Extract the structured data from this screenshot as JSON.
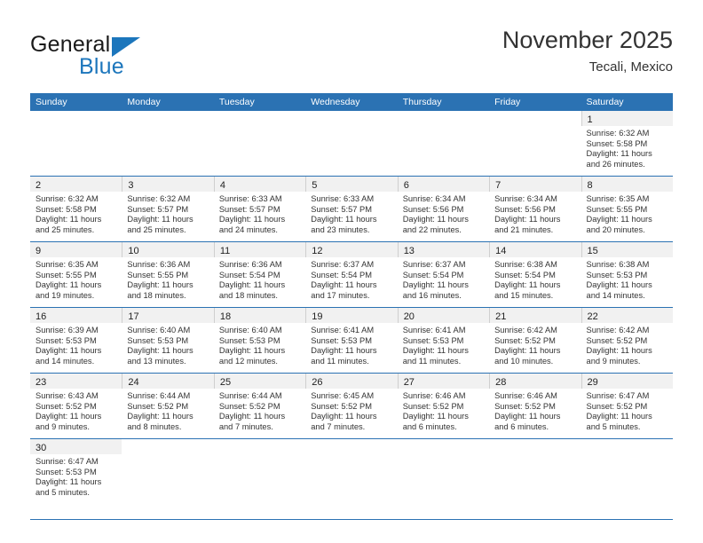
{
  "brand": {
    "word_top": "General",
    "word_bottom": "Blue",
    "accent_color": "#1c76bc"
  },
  "header": {
    "title": "November 2025",
    "subtitle": "Tecali, Mexico"
  },
  "calendar": {
    "header_bg": "#2b72b3",
    "row_divider_color": "#2b72b3",
    "daynum_band_bg": "#f1f1f1",
    "weekdays": [
      "Sunday",
      "Monday",
      "Tuesday",
      "Wednesday",
      "Thursday",
      "Friday",
      "Saturday"
    ],
    "weeks": [
      [
        {
          "day": "",
          "sunrise": "",
          "sunset": "",
          "daylight_line1": "",
          "daylight_line2": "",
          "blank": true
        },
        {
          "day": "",
          "sunrise": "",
          "sunset": "",
          "daylight_line1": "",
          "daylight_line2": "",
          "blank": true
        },
        {
          "day": "",
          "sunrise": "",
          "sunset": "",
          "daylight_line1": "",
          "daylight_line2": "",
          "blank": true
        },
        {
          "day": "",
          "sunrise": "",
          "sunset": "",
          "daylight_line1": "",
          "daylight_line2": "",
          "blank": true
        },
        {
          "day": "",
          "sunrise": "",
          "sunset": "",
          "daylight_line1": "",
          "daylight_line2": "",
          "blank": true
        },
        {
          "day": "",
          "sunrise": "",
          "sunset": "",
          "daylight_line1": "",
          "daylight_line2": "",
          "blank": true
        },
        {
          "day": "1",
          "sunrise": "Sunrise: 6:32 AM",
          "sunset": "Sunset: 5:58 PM",
          "daylight_line1": "Daylight: 11 hours",
          "daylight_line2": "and 26 minutes."
        }
      ],
      [
        {
          "day": "2",
          "sunrise": "Sunrise: 6:32 AM",
          "sunset": "Sunset: 5:58 PM",
          "daylight_line1": "Daylight: 11 hours",
          "daylight_line2": "and 25 minutes."
        },
        {
          "day": "3",
          "sunrise": "Sunrise: 6:32 AM",
          "sunset": "Sunset: 5:57 PM",
          "daylight_line1": "Daylight: 11 hours",
          "daylight_line2": "and 25 minutes."
        },
        {
          "day": "4",
          "sunrise": "Sunrise: 6:33 AM",
          "sunset": "Sunset: 5:57 PM",
          "daylight_line1": "Daylight: 11 hours",
          "daylight_line2": "and 24 minutes."
        },
        {
          "day": "5",
          "sunrise": "Sunrise: 6:33 AM",
          "sunset": "Sunset: 5:57 PM",
          "daylight_line1": "Daylight: 11 hours",
          "daylight_line2": "and 23 minutes."
        },
        {
          "day": "6",
          "sunrise": "Sunrise: 6:34 AM",
          "sunset": "Sunset: 5:56 PM",
          "daylight_line1": "Daylight: 11 hours",
          "daylight_line2": "and 22 minutes."
        },
        {
          "day": "7",
          "sunrise": "Sunrise: 6:34 AM",
          "sunset": "Sunset: 5:56 PM",
          "daylight_line1": "Daylight: 11 hours",
          "daylight_line2": "and 21 minutes."
        },
        {
          "day": "8",
          "sunrise": "Sunrise: 6:35 AM",
          "sunset": "Sunset: 5:55 PM",
          "daylight_line1": "Daylight: 11 hours",
          "daylight_line2": "and 20 minutes."
        }
      ],
      [
        {
          "day": "9",
          "sunrise": "Sunrise: 6:35 AM",
          "sunset": "Sunset: 5:55 PM",
          "daylight_line1": "Daylight: 11 hours",
          "daylight_line2": "and 19 minutes."
        },
        {
          "day": "10",
          "sunrise": "Sunrise: 6:36 AM",
          "sunset": "Sunset: 5:55 PM",
          "daylight_line1": "Daylight: 11 hours",
          "daylight_line2": "and 18 minutes."
        },
        {
          "day": "11",
          "sunrise": "Sunrise: 6:36 AM",
          "sunset": "Sunset: 5:54 PM",
          "daylight_line1": "Daylight: 11 hours",
          "daylight_line2": "and 18 minutes."
        },
        {
          "day": "12",
          "sunrise": "Sunrise: 6:37 AM",
          "sunset": "Sunset: 5:54 PM",
          "daylight_line1": "Daylight: 11 hours",
          "daylight_line2": "and 17 minutes."
        },
        {
          "day": "13",
          "sunrise": "Sunrise: 6:37 AM",
          "sunset": "Sunset: 5:54 PM",
          "daylight_line1": "Daylight: 11 hours",
          "daylight_line2": "and 16 minutes."
        },
        {
          "day": "14",
          "sunrise": "Sunrise: 6:38 AM",
          "sunset": "Sunset: 5:54 PM",
          "daylight_line1": "Daylight: 11 hours",
          "daylight_line2": "and 15 minutes."
        },
        {
          "day": "15",
          "sunrise": "Sunrise: 6:38 AM",
          "sunset": "Sunset: 5:53 PM",
          "daylight_line1": "Daylight: 11 hours",
          "daylight_line2": "and 14 minutes."
        }
      ],
      [
        {
          "day": "16",
          "sunrise": "Sunrise: 6:39 AM",
          "sunset": "Sunset: 5:53 PM",
          "daylight_line1": "Daylight: 11 hours",
          "daylight_line2": "and 14 minutes."
        },
        {
          "day": "17",
          "sunrise": "Sunrise: 6:40 AM",
          "sunset": "Sunset: 5:53 PM",
          "daylight_line1": "Daylight: 11 hours",
          "daylight_line2": "and 13 minutes."
        },
        {
          "day": "18",
          "sunrise": "Sunrise: 6:40 AM",
          "sunset": "Sunset: 5:53 PM",
          "daylight_line1": "Daylight: 11 hours",
          "daylight_line2": "and 12 minutes."
        },
        {
          "day": "19",
          "sunrise": "Sunrise: 6:41 AM",
          "sunset": "Sunset: 5:53 PM",
          "daylight_line1": "Daylight: 11 hours",
          "daylight_line2": "and 11 minutes."
        },
        {
          "day": "20",
          "sunrise": "Sunrise: 6:41 AM",
          "sunset": "Sunset: 5:53 PM",
          "daylight_line1": "Daylight: 11 hours",
          "daylight_line2": "and 11 minutes."
        },
        {
          "day": "21",
          "sunrise": "Sunrise: 6:42 AM",
          "sunset": "Sunset: 5:52 PM",
          "daylight_line1": "Daylight: 11 hours",
          "daylight_line2": "and 10 minutes."
        },
        {
          "day": "22",
          "sunrise": "Sunrise: 6:42 AM",
          "sunset": "Sunset: 5:52 PM",
          "daylight_line1": "Daylight: 11 hours",
          "daylight_line2": "and 9 minutes."
        }
      ],
      [
        {
          "day": "23",
          "sunrise": "Sunrise: 6:43 AM",
          "sunset": "Sunset: 5:52 PM",
          "daylight_line1": "Daylight: 11 hours",
          "daylight_line2": "and 9 minutes."
        },
        {
          "day": "24",
          "sunrise": "Sunrise: 6:44 AM",
          "sunset": "Sunset: 5:52 PM",
          "daylight_line1": "Daylight: 11 hours",
          "daylight_line2": "and 8 minutes."
        },
        {
          "day": "25",
          "sunrise": "Sunrise: 6:44 AM",
          "sunset": "Sunset: 5:52 PM",
          "daylight_line1": "Daylight: 11 hours",
          "daylight_line2": "and 7 minutes."
        },
        {
          "day": "26",
          "sunrise": "Sunrise: 6:45 AM",
          "sunset": "Sunset: 5:52 PM",
          "daylight_line1": "Daylight: 11 hours",
          "daylight_line2": "and 7 minutes."
        },
        {
          "day": "27",
          "sunrise": "Sunrise: 6:46 AM",
          "sunset": "Sunset: 5:52 PM",
          "daylight_line1": "Daylight: 11 hours",
          "daylight_line2": "and 6 minutes."
        },
        {
          "day": "28",
          "sunrise": "Sunrise: 6:46 AM",
          "sunset": "Sunset: 5:52 PM",
          "daylight_line1": "Daylight: 11 hours",
          "daylight_line2": "and 6 minutes."
        },
        {
          "day": "29",
          "sunrise": "Sunrise: 6:47 AM",
          "sunset": "Sunset: 5:52 PM",
          "daylight_line1": "Daylight: 11 hours",
          "daylight_line2": "and 5 minutes."
        }
      ],
      [
        {
          "day": "30",
          "sunrise": "Sunrise: 6:47 AM",
          "sunset": "Sunset: 5:53 PM",
          "daylight_line1": "Daylight: 11 hours",
          "daylight_line2": "and 5 minutes."
        },
        {
          "day": "",
          "sunrise": "",
          "sunset": "",
          "daylight_line1": "",
          "daylight_line2": "",
          "blank": true
        },
        {
          "day": "",
          "sunrise": "",
          "sunset": "",
          "daylight_line1": "",
          "daylight_line2": "",
          "blank": true
        },
        {
          "day": "",
          "sunrise": "",
          "sunset": "",
          "daylight_line1": "",
          "daylight_line2": "",
          "blank": true
        },
        {
          "day": "",
          "sunrise": "",
          "sunset": "",
          "daylight_line1": "",
          "daylight_line2": "",
          "blank": true
        },
        {
          "day": "",
          "sunrise": "",
          "sunset": "",
          "daylight_line1": "",
          "daylight_line2": "",
          "blank": true
        },
        {
          "day": "",
          "sunrise": "",
          "sunset": "",
          "daylight_line1": "",
          "daylight_line2": "",
          "blank": true
        }
      ]
    ]
  }
}
